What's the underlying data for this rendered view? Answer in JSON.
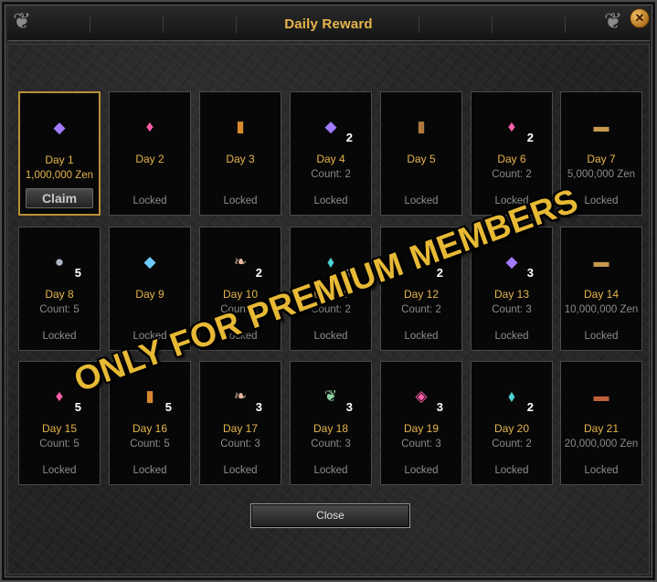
{
  "window": {
    "title": "Daily Reward",
    "close_x": "✕"
  },
  "colors": {
    "gold": "#e6b54c",
    "gray_text": "#8d8d8d",
    "card_bg": "#070707",
    "active_border": "#b89038"
  },
  "days": [
    {
      "name": "Day 1",
      "sub": "1,000,000 Zen",
      "status": "",
      "qty": "",
      "icon": "purple-gem-icon",
      "glyph": "◆",
      "color": "#a27bff",
      "active": true,
      "claim_label": "Claim"
    },
    {
      "name": "Day 2",
      "sub": "",
      "status": "Locked",
      "qty": "",
      "icon": "pink-gem-icon",
      "glyph": "♦",
      "color": "#ff5fa8"
    },
    {
      "name": "Day 3",
      "sub": "",
      "status": "Locked",
      "qty": "",
      "icon": "small-scroll-icon",
      "glyph": "▮",
      "color": "#d9892f"
    },
    {
      "name": "Day 4",
      "sub": "Count: 2",
      "status": "Locked",
      "qty": "2",
      "icon": "purple-gem-icon",
      "glyph": "◆",
      "color": "#a27bff"
    },
    {
      "name": "Day 5",
      "sub": "",
      "status": "Locked",
      "qty": "",
      "icon": "barrel-icon",
      "glyph": "▮",
      "color": "#b07a3d"
    },
    {
      "name": "Day 6",
      "sub": "Count: 2",
      "status": "Locked",
      "qty": "2",
      "icon": "pink-gem-icon",
      "glyph": "♦",
      "color": "#ff5fa8"
    },
    {
      "name": "Day 7",
      "sub": "5,000,000 Zen",
      "status": "Locked",
      "qty": "",
      "icon": "treasure-chest-icon",
      "glyph": "▬",
      "color": "#c79a4f"
    },
    {
      "name": "Day 8",
      "sub": "Count: 5",
      "status": "Locked",
      "qty": "5",
      "icon": "ore-rock-icon",
      "glyph": "●",
      "color": "#aeb4c4"
    },
    {
      "name": "Day 9",
      "sub": "",
      "status": "Locked",
      "qty": "",
      "icon": "blue-crystal-icon",
      "glyph": "◆",
      "color": "#6ecbff"
    },
    {
      "name": "Day 10",
      "sub": "Count: 2",
      "status": "Locked",
      "qty": "2",
      "icon": "feather-icon",
      "glyph": "❧",
      "color": "#e8b8a0"
    },
    {
      "name": "Day 11",
      "sub": "Count: 2",
      "status": "Locked",
      "qty": "2",
      "icon": "cyan-crystal-icon",
      "glyph": "⬧",
      "color": "#4ed2d2"
    },
    {
      "name": "Day 12",
      "sub": "Count: 2",
      "status": "Locked",
      "qty": "2",
      "icon": "pink-gem-icon",
      "glyph": "♦",
      "color": "#ff5fa8"
    },
    {
      "name": "Day 13",
      "sub": "Count: 3",
      "status": "Locked",
      "qty": "3",
      "icon": "purple-gem-icon",
      "glyph": "◆",
      "color": "#a27bff"
    },
    {
      "name": "Day 14",
      "sub": "10,000,000 Zen",
      "status": "Locked",
      "qty": "",
      "icon": "treasure-chest-icon",
      "glyph": "▬",
      "color": "#c79a4f"
    },
    {
      "name": "Day 15",
      "sub": "Count: 5",
      "status": "Locked",
      "qty": "5",
      "icon": "pink-gem-icon",
      "glyph": "♦",
      "color": "#ff5fa8"
    },
    {
      "name": "Day 16",
      "sub": "Count: 5",
      "status": "Locked",
      "qty": "5",
      "icon": "small-scroll-icon",
      "glyph": "▮",
      "color": "#d9892f"
    },
    {
      "name": "Day 17",
      "sub": "Count: 3",
      "status": "Locked",
      "qty": "3",
      "icon": "feather-icon",
      "glyph": "❧",
      "color": "#e8b8a0"
    },
    {
      "name": "Day 18",
      "sub": "Count: 3",
      "status": "Locked",
      "qty": "3",
      "icon": "green-rune-icon",
      "glyph": "❦",
      "color": "#8fd0a0"
    },
    {
      "name": "Day 19",
      "sub": "Count: 3",
      "status": "Locked",
      "qty": "3",
      "icon": "pink-diamond-icon",
      "glyph": "◈",
      "color": "#ff5fa8"
    },
    {
      "name": "Day 20",
      "sub": "Count: 2",
      "status": "Locked",
      "qty": "2",
      "icon": "cyan-crystal-icon",
      "glyph": "⬧",
      "color": "#4ed2d2"
    },
    {
      "name": "Day 21",
      "sub": "20,000,000 Zen",
      "status": "Locked",
      "qty": "",
      "icon": "red-chest-icon",
      "glyph": "▬",
      "color": "#c0603a"
    }
  ],
  "watermark": "ONLY FOR PREMIUM MEMBERS",
  "close_button": {
    "label": "Close"
  }
}
